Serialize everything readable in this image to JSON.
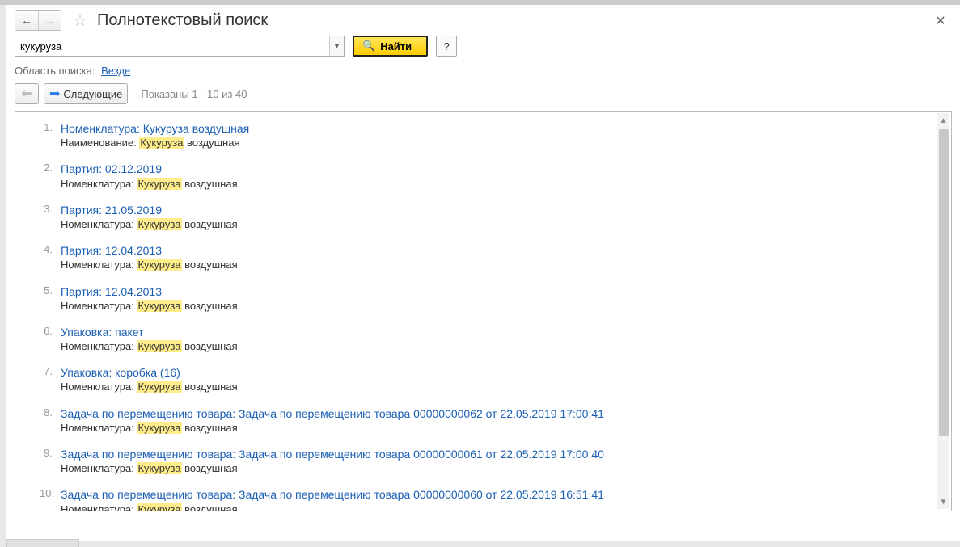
{
  "header": {
    "title": "Полнотекстовый поиск"
  },
  "search": {
    "value": "кукуруза",
    "find_label": "Найти",
    "help_label": "?"
  },
  "scope": {
    "label": "Область поиска:",
    "link": "Везде"
  },
  "pager": {
    "next_label": "Следующие",
    "status": "Показаны 1 - 10 из 40"
  },
  "highlight_term": "Кукуруза",
  "results": [
    {
      "num": "1.",
      "title": "Номенклатура: Кукуруза воздушная",
      "sub_prefix": "Наименование: ",
      "sub_suffix": " воздушная"
    },
    {
      "num": "2.",
      "title": "Партия: 02.12.2019",
      "sub_prefix": "Номенклатура: ",
      "sub_suffix": " воздушная"
    },
    {
      "num": "3.",
      "title": "Партия: 21.05.2019",
      "sub_prefix": "Номенклатура: ",
      "sub_suffix": " воздушная"
    },
    {
      "num": "4.",
      "title": "Партия: 12.04.2013",
      "sub_prefix": "Номенклатура: ",
      "sub_suffix": " воздушная"
    },
    {
      "num": "5.",
      "title": "Партия: 12.04.2013",
      "sub_prefix": "Номенклатура: ",
      "sub_suffix": " воздушная"
    },
    {
      "num": "6.",
      "title": "Упаковка: пакет",
      "sub_prefix": "Номенклатура: ",
      "sub_suffix": " воздушная"
    },
    {
      "num": "7.",
      "title": "Упаковка: коробка (16)",
      "sub_prefix": "Номенклатура: ",
      "sub_suffix": " воздушная"
    },
    {
      "num": "8.",
      "title": "Задача по перемещению товара: Задача по перемещению товара 00000000062 от 22.05.2019 17:00:41",
      "sub_prefix": "Номенклатура: ",
      "sub_suffix": " воздушная"
    },
    {
      "num": "9.",
      "title": "Задача по перемещению товара: Задача по перемещению товара 00000000061 от 22.05.2019 17:00:40",
      "sub_prefix": "Номенклатура: ",
      "sub_suffix": " воздушная"
    },
    {
      "num": "10.",
      "title": "Задача по перемещению товара: Задача по перемещению товара 00000000060 от 22.05.2019 16:51:41",
      "sub_prefix": "Номенклатура: ",
      "sub_suffix": " воздушная"
    }
  ]
}
